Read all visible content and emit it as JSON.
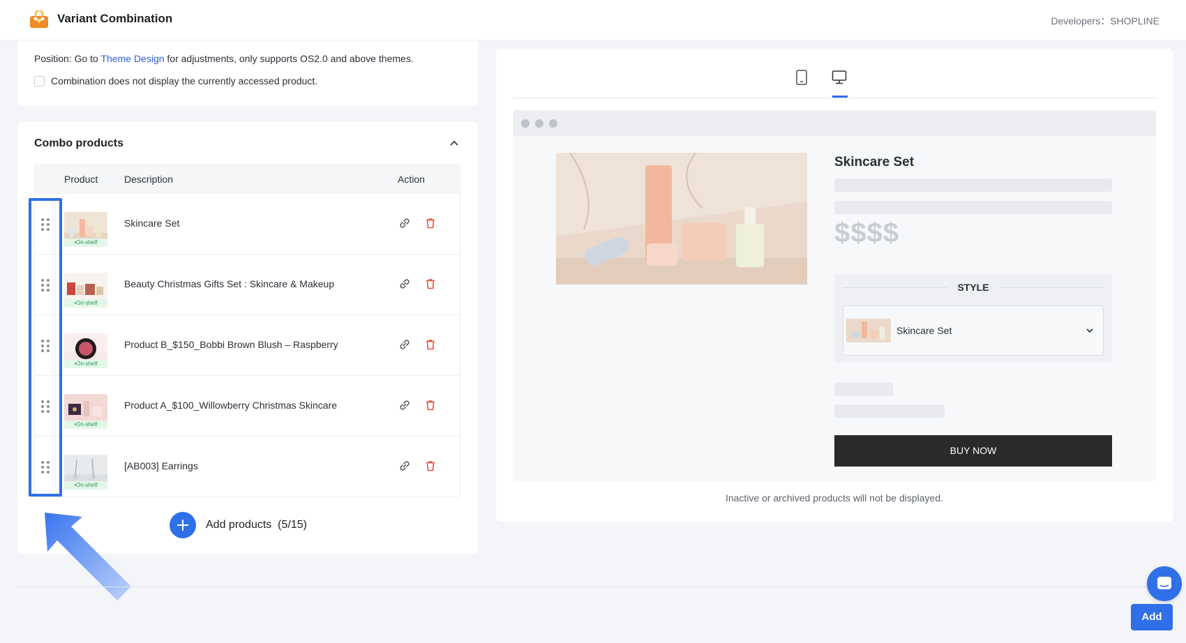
{
  "app": {
    "title": "Variant Combination",
    "developers": "Developers：SHOPLINE",
    "icon": "gift-bag-icon"
  },
  "position": {
    "prefix": "Position: Go to ",
    "link": "Theme Design",
    "suffix": " for adjustments, only supports OS2.0 and above themes.",
    "checkbox_label": "Combination does not display the currently accessed product.",
    "checkbox_checked": false
  },
  "combo": {
    "title": "Combo products",
    "columns": {
      "product": "Product",
      "description": "Description",
      "action": "Action"
    },
    "status_label": "•On-shelf",
    "items": [
      {
        "description": "Skincare Set"
      },
      {
        "description": "Beauty Christmas Gifts Set : Skincare & Makeup"
      },
      {
        "description": "Product B_$150_Bobbi Brown Blush – Raspberry"
      },
      {
        "description": "Product A_$100_Willowberry Christmas Skincare"
      },
      {
        "description": "[AB003] Earrings"
      }
    ],
    "add_label": "Add products",
    "add_count": "(5/15)"
  },
  "preview": {
    "tabs": [
      "mobile-icon",
      "desktop-icon"
    ],
    "active_tab": "desktop",
    "product_name": "Skincare Set",
    "price_placeholder": "$$$$",
    "style_label": "STYLE",
    "style_selected": "Skincare Set",
    "buy_now": "BUY NOW",
    "note": "Inactive or archived products will not be displayed."
  },
  "footer": {
    "add_button": "Add",
    "chat_icon": "chat-icon"
  },
  "colors": {
    "accent": "#2f6fe8",
    "onshelf": "#1f9d55",
    "delete": "#e5533d"
  }
}
